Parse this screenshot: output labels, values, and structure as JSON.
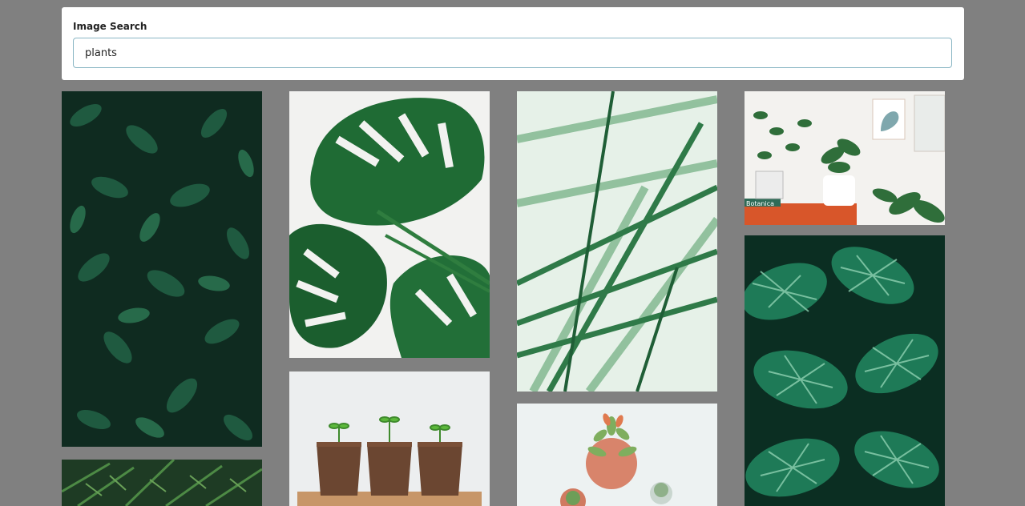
{
  "search": {
    "label": "Image Search",
    "value": "plants"
  },
  "results": [
    {
      "name": "dense-green-leaves-image",
      "subject": "dense green leaves"
    },
    {
      "name": "monstera-leaves-image",
      "subject": "monstera leaves"
    },
    {
      "name": "palm-fronds-image",
      "subject": "palm fronds"
    },
    {
      "name": "shelf-houseplants-image",
      "subject": "houseplants on shelf",
      "visible_text": "Botanica"
    },
    {
      "name": "calathea-leaves-image",
      "subject": "striped calathea leaves"
    },
    {
      "name": "fern-leaves-image",
      "subject": "fern leaves"
    },
    {
      "name": "seedling-pots-image",
      "subject": "seedlings in peat pots"
    },
    {
      "name": "succulent-pots-image",
      "subject": "succulents in pots"
    }
  ]
}
